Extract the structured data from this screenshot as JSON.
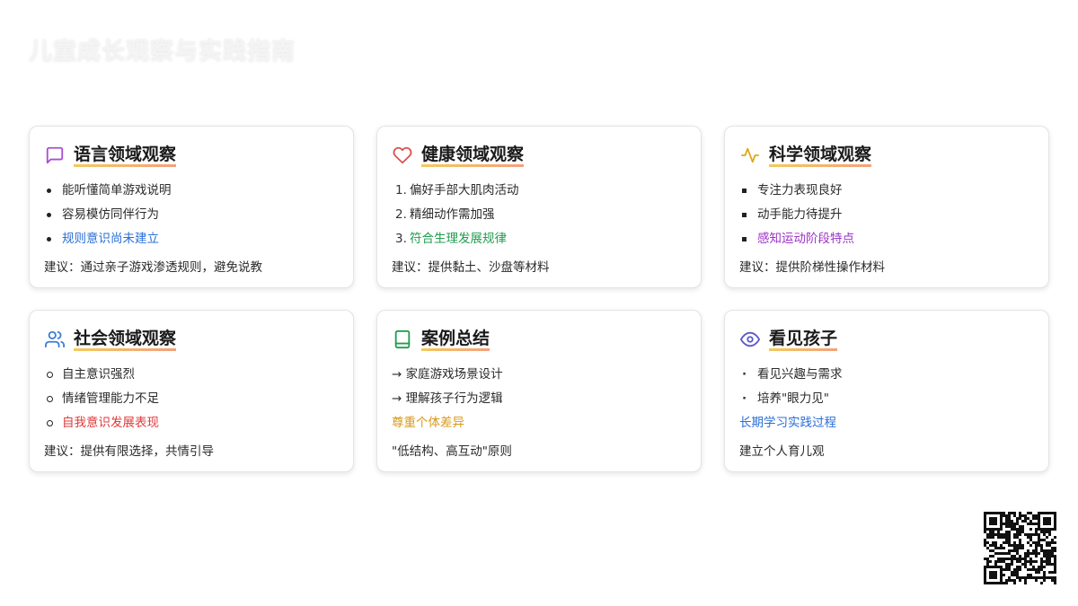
{
  "page": {
    "title": "儿童成长观察与实践指南"
  },
  "cards": [
    {
      "title": "语言领域观察",
      "icon": "message-square-icon",
      "items": [
        "能听懂简单游戏说明",
        "容易模仿同伴行为",
        "规则意识尚未建立"
      ],
      "advice": "建议：通过亲子游戏渗透规则，避免说教"
    },
    {
      "title": "健康领域观察",
      "icon": "heart-icon",
      "markers": [
        "1.",
        "2.",
        "3."
      ],
      "items": [
        "偏好手部大肌肉活动",
        "精细动作需加强",
        "符合生理发展规律"
      ],
      "advice": "建议：提供黏土、沙盘等材料"
    },
    {
      "title": "科学领域观察",
      "icon": "activity-icon",
      "items": [
        "专注力表现良好",
        "动手能力待提升",
        "感知运动阶段特点"
      ],
      "advice": "建议：提供阶梯性操作材料"
    },
    {
      "title": "社会领域观察",
      "icon": "users-icon",
      "items": [
        "自主意识强烈",
        "情绪管理能力不足",
        "自我意识发展表现"
      ],
      "advice": "建议：提供有限选择，共情引导"
    },
    {
      "title": "案例总结",
      "icon": "book-icon",
      "items": [
        "→ 家庭游戏场景设计",
        "→ 理解孩子行为逻辑",
        "尊重个体差异"
      ],
      "advice": "\"低结构、高互动\"原则"
    },
    {
      "title": "看见孩子",
      "icon": "eye-icon",
      "items": [
        "看见兴趣与需求",
        "培养\"眼力见\"",
        "长期学习实践过程"
      ],
      "advice": "建立个人育儿观"
    }
  ],
  "colors": {
    "highlight_blue": "#2b6fd6",
    "highlight_green": "#1f9d4e",
    "highlight_purple": "#9b35c7",
    "highlight_red": "#e03a3a",
    "highlight_orange": "#d99a1a",
    "title_underline": "#f4b07a"
  },
  "qr_code": {
    "icon": "qr-code-icon"
  }
}
